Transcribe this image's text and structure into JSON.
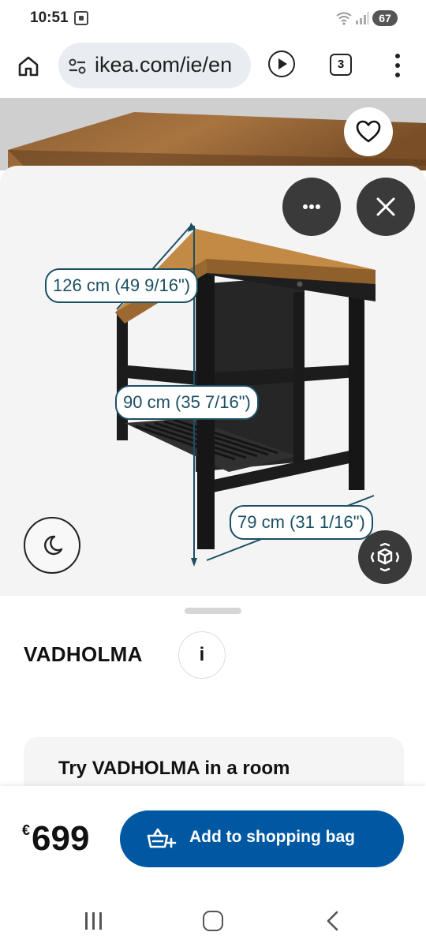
{
  "status_bar": {
    "time": "10:51",
    "battery": "67",
    "icons": [
      "screenshot-icon",
      "wifi-icon",
      "signal-icon",
      "battery-icon"
    ]
  },
  "browser": {
    "url": "ikea.com/ie/en",
    "tab_count": "3",
    "icons": [
      "home-icon",
      "site-settings-icon",
      "play-icon",
      "tabs-icon",
      "menu-icon"
    ]
  },
  "viewer": {
    "dimensions": {
      "width": "126 cm (49 9/16\")",
      "height": "90 cm (35 7/16\")",
      "depth": "79 cm (31 1/16\")"
    },
    "icons": [
      "heart-icon",
      "more-icon",
      "close-icon",
      "moon-icon",
      "ar-icon"
    ],
    "colors": {
      "button_bg": "#3a3a3a",
      "dimension_line": "#1b4f63",
      "wood": "#b07a3a",
      "frame": "#1c1c1c"
    }
  },
  "product": {
    "name": "VADHOLMA",
    "info_label": "i",
    "try_room": "Try VADHOLMA in a room"
  },
  "purchase": {
    "currency": "€",
    "price": "699",
    "add_to_bag": "Add to shopping bag",
    "button_color": "#0058a3"
  },
  "nav": {
    "icons": [
      "recents-icon",
      "home-icon",
      "back-icon"
    ]
  }
}
